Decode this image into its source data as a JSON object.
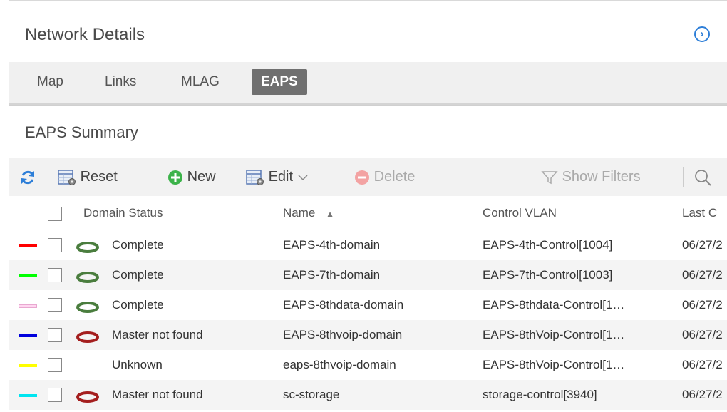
{
  "panel": {
    "title": "Network Details"
  },
  "tabs": [
    {
      "label": "Map",
      "active": false
    },
    {
      "label": "Links",
      "active": false
    },
    {
      "label": "MLAG",
      "active": false
    },
    {
      "label": "EAPS",
      "active": true
    }
  ],
  "summary": {
    "title": "EAPS Summary"
  },
  "toolbar": {
    "reset_label": "Reset",
    "new_label": "New",
    "edit_label": "Edit",
    "delete_label": "Delete",
    "filters_label": "Show Filters"
  },
  "table": {
    "columns": [
      "Domain Status",
      "Name",
      "Control VLAN",
      "Last C"
    ],
    "sort_indicator": "▲",
    "rows": [
      {
        "swatch": "#ff0000",
        "status_icon": "green-ring-icon",
        "status": "Complete",
        "name": "EAPS-4th-domain",
        "control_vlan": "EAPS-4th-Control[1004]",
        "last": "06/27/2"
      },
      {
        "swatch": "#00ff00",
        "status_icon": "green-ring-icon",
        "status": "Complete",
        "name": "EAPS-7th-domain",
        "control_vlan": "EAPS-7th-Control[1003]",
        "last": "06/27/2"
      },
      {
        "swatch": "#ffd6f0",
        "status_icon": "green-ring-icon",
        "status": "Complete",
        "name": "EAPS-8thdata-domain",
        "control_vlan": "EAPS-8thdata-Control[1…",
        "last": "06/27/2"
      },
      {
        "swatch": "#0000dd",
        "status_icon": "red-ring-icon",
        "status": "Master not found",
        "name": "EAPS-8thvoip-domain",
        "control_vlan": "EAPS-8thVoip-Control[1…",
        "last": "06/27/2"
      },
      {
        "swatch": "#ffff00",
        "status_icon": "",
        "status": "Unknown",
        "name": "eaps-8thvoip-domain",
        "control_vlan": "EAPS-8thVoip-Control[1…",
        "last": "06/27/2"
      },
      {
        "swatch": "#00e5f0",
        "status_icon": "red-ring-icon",
        "status": "Master not found",
        "name": "sc-storage",
        "control_vlan": "storage-control[3940]",
        "last": "06/27/2"
      }
    ]
  },
  "colors": {
    "accent": "#2e7fd8",
    "active_tab": "#707070",
    "ring_green": "#4a7d3e",
    "ring_red": "#a41e1e"
  }
}
